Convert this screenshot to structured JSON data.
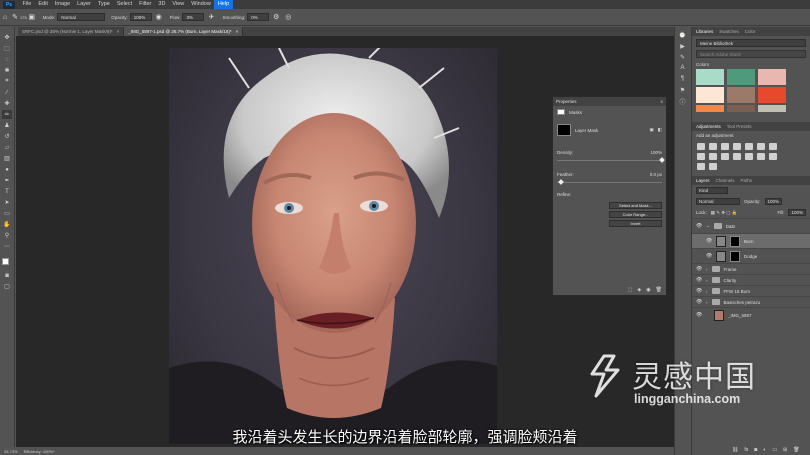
{
  "menubar": {
    "logo": "Ps",
    "items": [
      "File",
      "Edit",
      "Image",
      "Layer",
      "Type",
      "Select",
      "Filter",
      "3D",
      "View",
      "Window",
      "Help"
    ],
    "active_item": "Help"
  },
  "options": {
    "brush_size": "175",
    "mode_label": "Mode:",
    "mode_value": "Normal",
    "opacity_label": "Opacity:",
    "opacity_value": "100%",
    "flow_label": "Flow:",
    "flow_value": "3%",
    "smoothing_label": "Smoothing:",
    "smoothing_value": "0%"
  },
  "tabs": [
    {
      "label": "SRFC.psd @ 25% (Normie 1, Layer Mask/8)*",
      "close": "×"
    },
    {
      "label": "_IMG_5897-1.psd @ 26.7% (Burn, Layer Mask/16)*",
      "close": "×"
    }
  ],
  "status": {
    "zoom": "26.73%",
    "efficiency": "Efficiency: 100%*"
  },
  "properties": {
    "title": "Properties",
    "masks_label": "Masks",
    "layer_mask_label": "Layer Mask",
    "density_label": "Density:",
    "density_value": "100%",
    "feather_label": "Feather:",
    "feather_value": "0.0 px",
    "refine_label": "Refine:",
    "select_mask": "Select and Mask...",
    "color_range": "Color Range...",
    "invert": "Invert"
  },
  "libraries": {
    "tabs": [
      "Libraries",
      "Swatches",
      "Color"
    ],
    "library_name": "Meine Bibliothek",
    "search_placeholder": "Search Adobe Stock",
    "colors_label": "Colors",
    "colors": [
      "#a8dcc8",
      "#4d9a7c",
      "#e8b7b0",
      "#fde6d6",
      "#9b7a6a",
      "#e8492c",
      "#f0884a",
      "#7a5e52",
      "#bfc0b2"
    ]
  },
  "adjustments": {
    "tabs": [
      "Adjustments",
      "Tool Presets"
    ],
    "add_label": "Add an adjustment"
  },
  "layers": {
    "tabs": [
      "Layers",
      "Channels",
      "Paths"
    ],
    "kind_label": "Kind",
    "blend_mode": "Normal",
    "opacity_label": "Opacity:",
    "opacity_value": "100%",
    "lock_label": "Lock:",
    "fill_label": "Fill:",
    "fill_value": "100%",
    "items": [
      {
        "name": "D&B",
        "type": "folder"
      },
      {
        "name": "Burn",
        "type": "mask",
        "selected": true
      },
      {
        "name": "Dodge",
        "type": "mask"
      },
      {
        "name": "Frame",
        "type": "folder"
      },
      {
        "name": "Clarity",
        "type": "folder"
      },
      {
        "name": "FFW 16 Bom",
        "type": "folder"
      },
      {
        "name": "Basisches petrazu",
        "type": "folder"
      },
      {
        "name": "_IMG_5897",
        "type": "image"
      }
    ]
  },
  "subtitle": "我沿着头发生长的边界沿着脸部轮廓，强调脸颊沿着",
  "watermark": {
    "cn": "灵感中国",
    "url": "lingganchina.com"
  }
}
